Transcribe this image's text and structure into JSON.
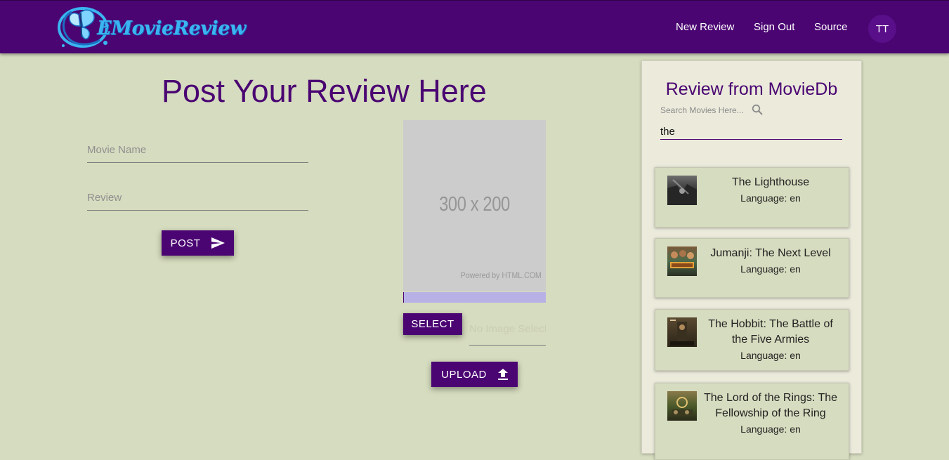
{
  "brand": {
    "name": "EMovieReview"
  },
  "nav": {
    "new_review": "New Review",
    "sign_out": "Sign Out",
    "source": "Source",
    "avatar_initials": "TT"
  },
  "form": {
    "title": "Post Your Review Here",
    "movie_name_placeholder": "Movie Name",
    "review_placeholder": "Review",
    "post_label": "POST"
  },
  "image_panel": {
    "placeholder_text": "300 x 200",
    "powered_by": "Powered by HTML.COM",
    "progress": 0,
    "select_label": "SELECT",
    "file_status": "No Image Selected",
    "upload_label": "UPLOAD"
  },
  "sidebar": {
    "title": "Review from MovieDb",
    "search_placeholder": "Search Movies Here...",
    "search_value": "the",
    "results": [
      {
        "title": "The Lighthouse",
        "language": "Language: en"
      },
      {
        "title": "Jumanji: The Next Level",
        "language": "Language: en"
      },
      {
        "title": "The Hobbit: The Battle of the Five Armies",
        "language": "Language: en"
      },
      {
        "title": "The Lord of the Rings: The Fellowship of the Ring",
        "language": "Language: en"
      }
    ]
  },
  "colors": {
    "primary": "#4a0572",
    "background": "#d6dcbf",
    "logo": "#3bb5f0",
    "sidebar": "#ebeadb",
    "progress": "#b7b1e6"
  },
  "icons": [
    "butterfly-logo-icon",
    "send-icon",
    "upload-icon",
    "search-icon"
  ]
}
